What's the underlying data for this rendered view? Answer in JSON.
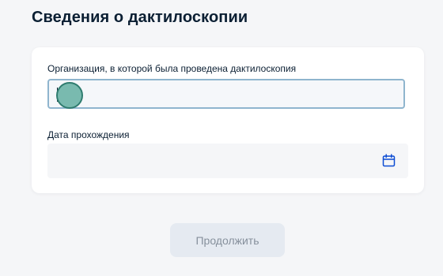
{
  "page": {
    "title": "Сведения о дактилоскопии"
  },
  "form": {
    "organization": {
      "label": "Организация, в которой была проведена дактилоскопия",
      "value": ""
    },
    "date": {
      "label": "Дата прохождения",
      "value": "",
      "icon": "calendar-icon"
    }
  },
  "actions": {
    "continue_label": "Продолжить",
    "continue_disabled": true
  },
  "colors": {
    "accent": "#0d4cd3",
    "focus_border": "#8fb5ce",
    "disabled_bg": "#e5eaf1",
    "disabled_text": "#86909c",
    "touch_indicator": "#4fa696"
  }
}
